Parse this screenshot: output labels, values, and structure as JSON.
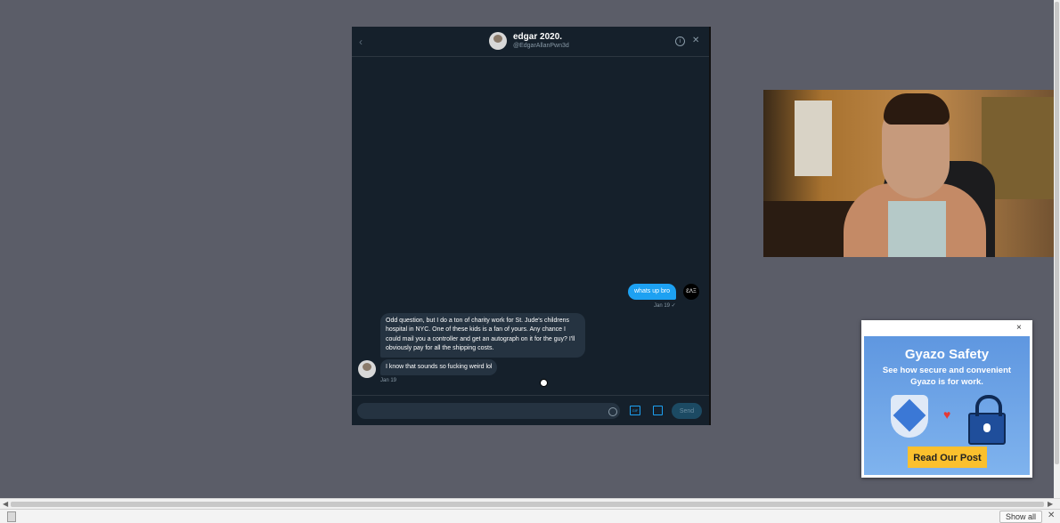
{
  "chat": {
    "name": "edgar 2020.",
    "handle": "@EdgarAllanPwn3d",
    "messages_out": [
      {
        "text": "whats up bro",
        "time": "Jan 19 ✓"
      }
    ],
    "out_avatar_label": "ƐΛΞ",
    "messages_in": [
      {
        "text": "Odd question, but I do a ton of charity work for St. Jude's childrens hospital in NYC. One of these kids is a fan of yours. Any chance I could mail you a controller and get an autograph on it for the guy? I'll obviously pay for all the shipping costs."
      },
      {
        "text": "I know that sounds so fucking weird lol",
        "time": "Jan 19"
      }
    ],
    "composer": {
      "placeholder": "",
      "gif_label": "GIF",
      "send_label": "Send"
    }
  },
  "ad": {
    "title": "Gyazo Safety",
    "subtitle": "See how secure and convenient Gyazo is for work.",
    "cta": "Read Our Post",
    "close": "×"
  },
  "downloads": {
    "file_label": "                ",
    "show_all": "Show all",
    "close": "✕"
  }
}
